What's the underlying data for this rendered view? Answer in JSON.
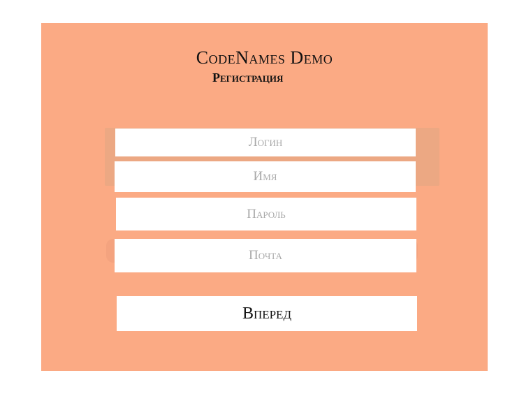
{
  "header": {
    "title": "CodeNames Demo",
    "subtitle": "Регистрация"
  },
  "form": {
    "login_placeholder": "Логин",
    "name_placeholder": "Имя",
    "password_placeholder": "Пароль",
    "email_placeholder": "Почта",
    "submit_label": "Вперед"
  },
  "colors": {
    "panel": "#fbaa84",
    "field": "#ffffff",
    "placeholder": "#a9a9a9",
    "text": "#111111"
  }
}
